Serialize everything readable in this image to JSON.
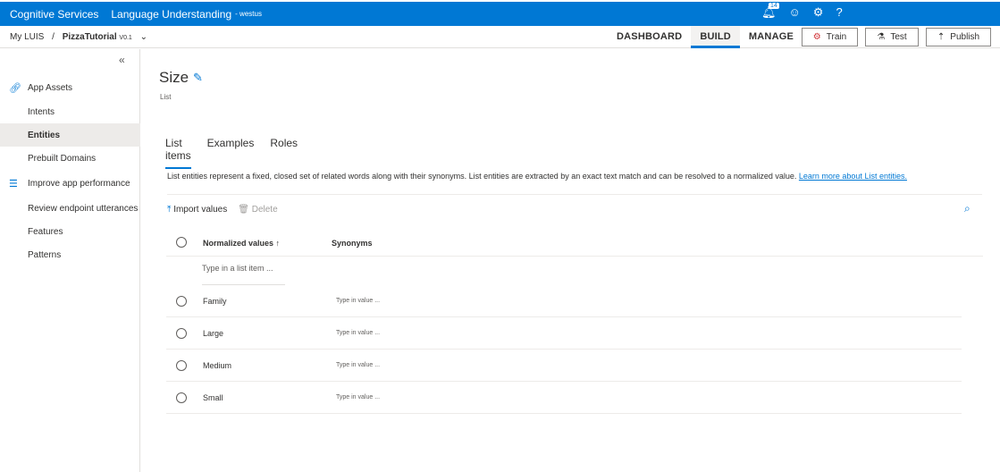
{
  "topbar": {
    "brand": "Cognitive Services",
    "app": "Language Understanding",
    "region": "- westus",
    "notifications": "14"
  },
  "nav": {
    "my_luis": "My LUIS",
    "sep": "/",
    "app_name": "PizzaTutorial",
    "version": "V0.1",
    "tabs": [
      "DASHBOARD",
      "BUILD",
      "MANAGE"
    ],
    "train": "Train",
    "test": "Test",
    "publish": "Publish"
  },
  "sidebar": {
    "items": [
      "App Assets",
      "Intents",
      "Entities",
      "Prebuilt Domains",
      "Improve app performance",
      "Review endpoint utterances",
      "Features",
      "Patterns"
    ]
  },
  "entity": {
    "name": "Size",
    "type": "List",
    "tabs": [
      "List items",
      "Examples",
      "Roles"
    ],
    "description": "List entities represent a fixed, closed set of related words along with their synonyms. List entities are extracted by an exact text match and can be resolved to a normalized value.",
    "learn_more": "Learn more about List entities.",
    "import": "Import values",
    "delete": "Delete",
    "col_values": "Normalized values ↑",
    "col_synonyms": "Synonyms",
    "new_placeholder": "Type in a list item ...",
    "rows": [
      {
        "value": "Family",
        "synonyms": "Type in value ..."
      },
      {
        "value": "Large",
        "synonyms": "Type in value ..."
      },
      {
        "value": "Medium",
        "synonyms": "Type in value ..."
      },
      {
        "value": "Small",
        "synonyms": "Type in value ..."
      }
    ]
  }
}
